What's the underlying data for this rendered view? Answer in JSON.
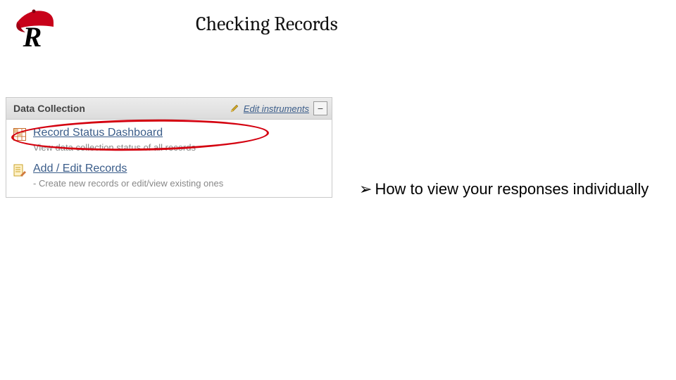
{
  "title": "Checking Records",
  "panel": {
    "header": "Data Collection",
    "edit_link": "Edit instruments",
    "collapse_symbol": "−",
    "items": [
      {
        "label": "Record Status Dashboard",
        "desc": "View data collection status of all records"
      },
      {
        "label": "Add / Edit Records",
        "desc": "- Create new records or edit/view existing ones"
      }
    ]
  },
  "bullet": {
    "marker": "➢",
    "text": "How to view your responses individually"
  }
}
